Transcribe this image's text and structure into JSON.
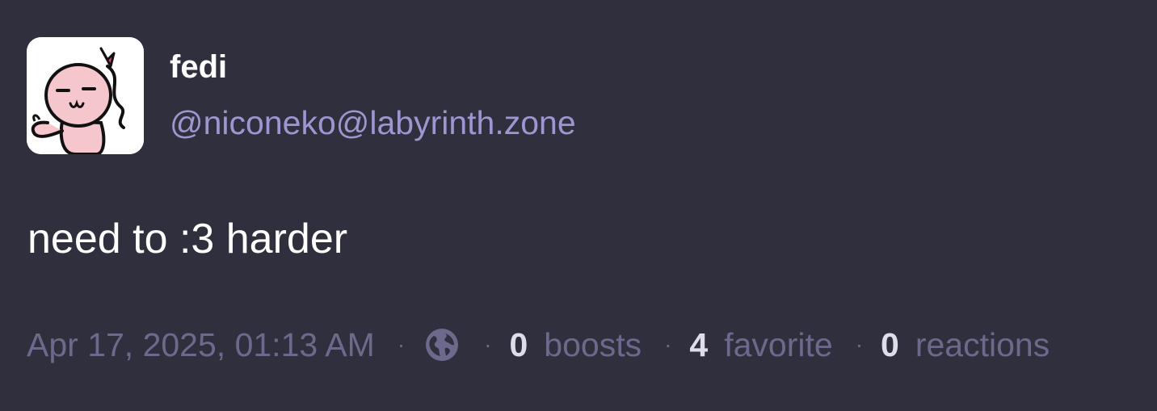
{
  "author": {
    "display_name": "fedi",
    "handle": "@niconeko@labyrinth.zone",
    "avatar_icon": "pink-cat-avatar"
  },
  "post": {
    "content": "need to :3 harder"
  },
  "meta": {
    "timestamp": "Apr 17, 2025, 01:13 AM",
    "separator": "·",
    "visibility_icon": "globe-icon",
    "boosts_count": "0",
    "boosts_label": "boosts",
    "favorites_count": "4",
    "favorites_label": "favorite",
    "reactions_count": "0",
    "reactions_label": "reactions"
  },
  "colors": {
    "background": "#302f3d",
    "handle": "#9c97d0",
    "muted": "#6c6a8c",
    "count": "#dedde8"
  }
}
